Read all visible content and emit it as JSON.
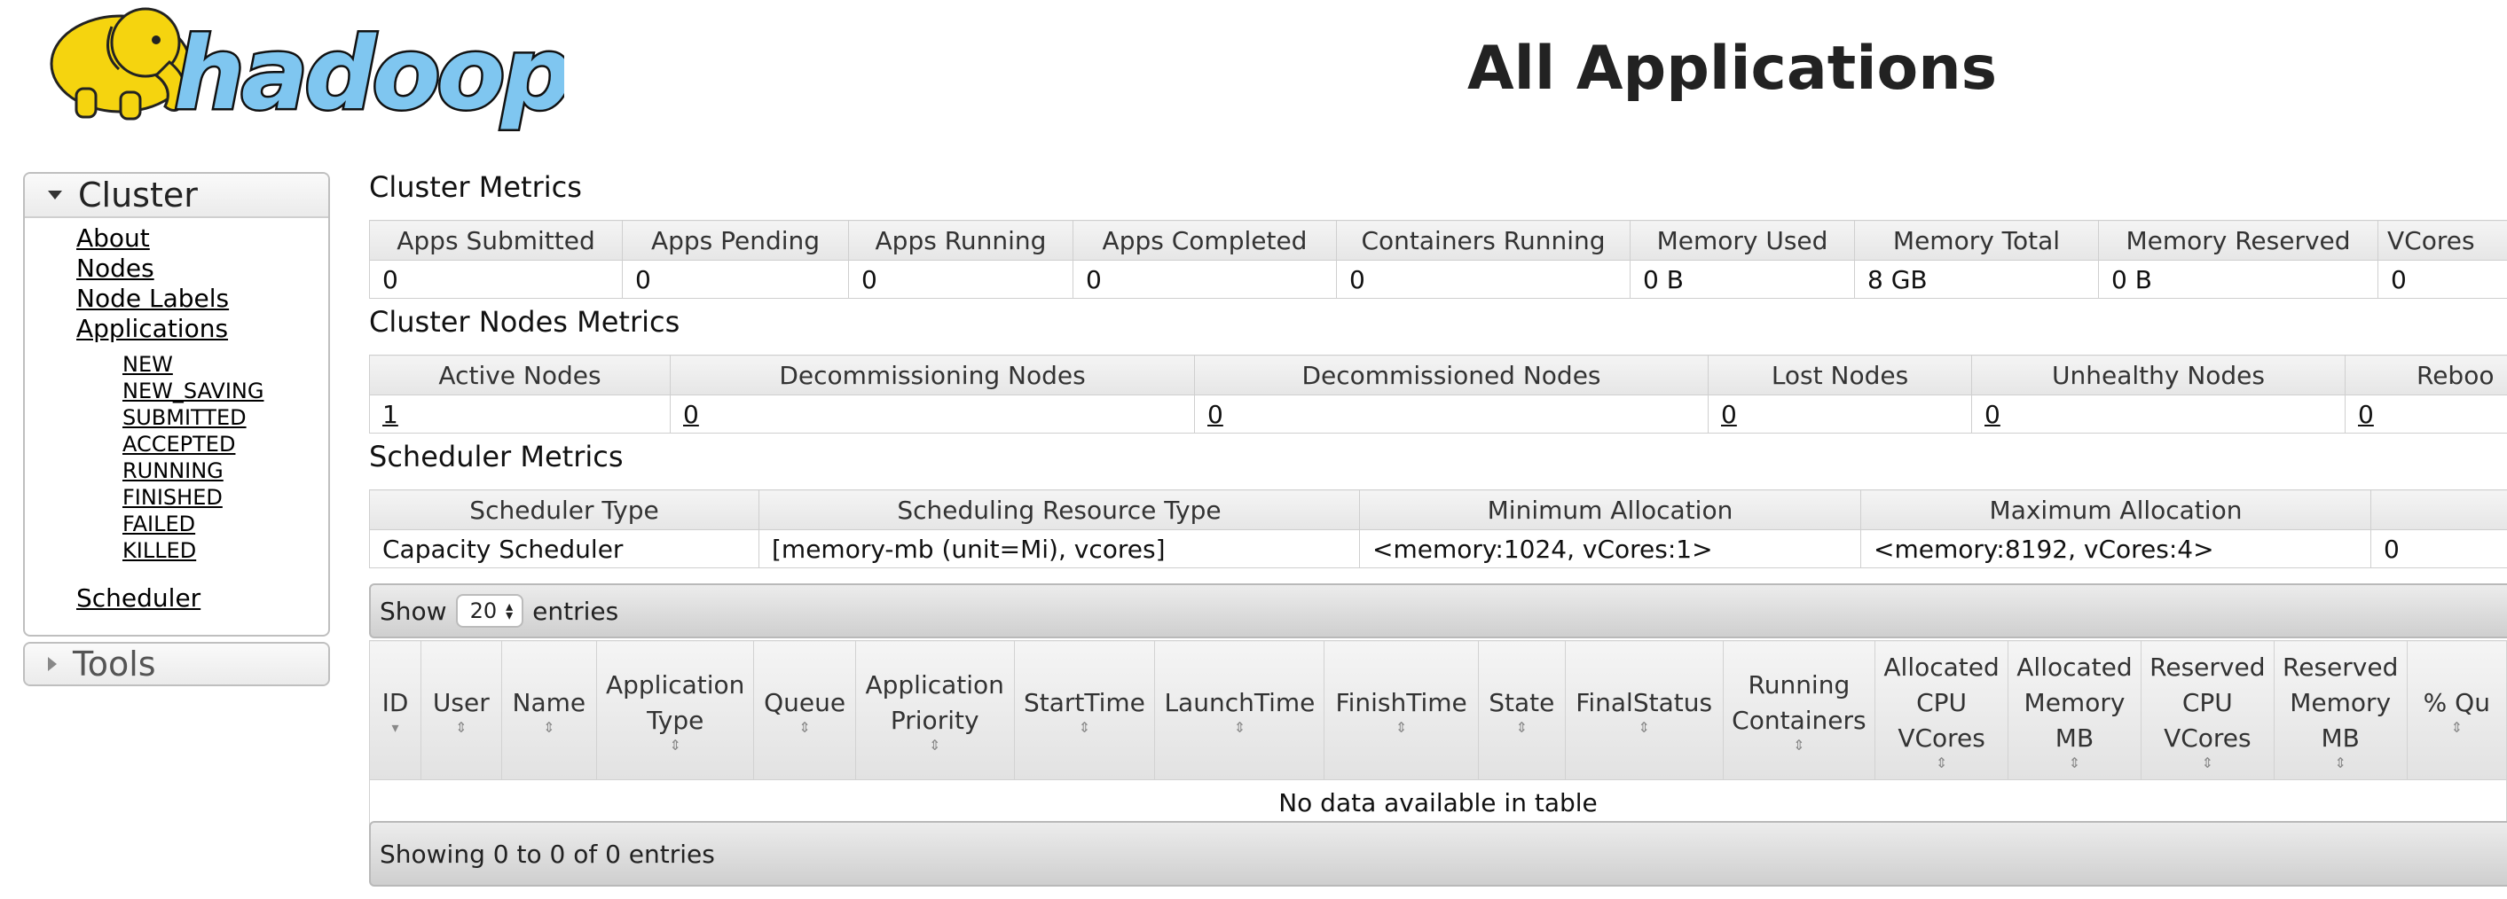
{
  "header": {
    "logo_text": "hadoop",
    "title": "All Applications"
  },
  "sidebar": {
    "cluster": {
      "label": "Cluster",
      "items": [
        {
          "label": "About"
        },
        {
          "label": "Nodes"
        },
        {
          "label": "Node Labels"
        },
        {
          "label": "Applications"
        }
      ],
      "app_states": [
        "NEW",
        "NEW_SAVING",
        "SUBMITTED",
        "ACCEPTED",
        "RUNNING",
        "FINISHED",
        "FAILED",
        "KILLED"
      ],
      "scheduler": "Scheduler"
    },
    "tools": {
      "label": "Tools"
    }
  },
  "cluster_metrics": {
    "title": "Cluster Metrics",
    "headers": [
      "Apps Submitted",
      "Apps Pending",
      "Apps Running",
      "Apps Completed",
      "Containers Running",
      "Memory Used",
      "Memory Total",
      "Memory Reserved",
      "VCores"
    ],
    "values": [
      "0",
      "0",
      "0",
      "0",
      "0",
      "0 B",
      "8 GB",
      "0 B",
      "0"
    ]
  },
  "cluster_nodes_metrics": {
    "title": "Cluster Nodes Metrics",
    "headers": [
      "Active Nodes",
      "Decommissioning Nodes",
      "Decommissioned Nodes",
      "Lost Nodes",
      "Unhealthy Nodes",
      "Reboo"
    ],
    "values": [
      "1",
      "0",
      "0",
      "0",
      "0",
      "0"
    ]
  },
  "scheduler_metrics": {
    "title": "Scheduler Metrics",
    "headers": [
      "Scheduler Type",
      "Scheduling Resource Type",
      "Minimum Allocation",
      "Maximum Allocation",
      ""
    ],
    "values": [
      "Capacity Scheduler",
      "[memory-mb (unit=Mi), vcores]",
      "<memory:1024, vCores:1>",
      "<memory:8192, vCores:4>",
      "0"
    ]
  },
  "apps": {
    "show_label": "Show",
    "page_size": "20",
    "entries_label": "entries",
    "columns": [
      "ID",
      "User",
      "Name",
      "Application Type",
      "Queue",
      "Application Priority",
      "StartTime",
      "LaunchTime",
      "FinishTime",
      "State",
      "FinalStatus",
      "Running Containers",
      "Allocated CPU VCores",
      "Allocated Memory MB",
      "Reserved CPU VCores",
      "Reserved Memory MB",
      "% Qu"
    ],
    "empty_message": "No data available in table",
    "info": "Showing 0 to 0 of 0 entries"
  },
  "colors": {
    "logo_blue": "#7fc6f0",
    "logo_yellow": "#f5d40f",
    "header_gray": "#e6e6e6"
  }
}
